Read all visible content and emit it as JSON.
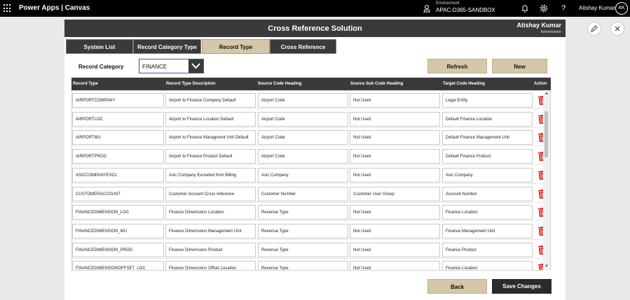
{
  "topbar": {
    "app_title": "Power Apps  |  Canvas",
    "environment_label": "Environment",
    "environment_name": "APAC-D365-SANDBOX",
    "help": "?",
    "user_name": "Atishay Kumar",
    "avatar_initials": "AK"
  },
  "header": {
    "title": "Cross Reference Solution",
    "user_name": "Atishay Kumar",
    "role": "Administrator"
  },
  "tabs": [
    {
      "label": "System List"
    },
    {
      "label": "Record Category Type"
    },
    {
      "label": "Record Type"
    },
    {
      "label": "Cross Reference"
    }
  ],
  "filter": {
    "label": "Record Category",
    "selected": "FINANCE"
  },
  "buttons": {
    "refresh": "Refresh",
    "new": "New",
    "back": "Back",
    "save": "Save Changes"
  },
  "table": {
    "columns": [
      "Record Type",
      "Record Type Description",
      "Source Code Heading",
      "Source Sub Code Heading",
      "Target Code Heading",
      "Action"
    ],
    "rows": [
      [
        "AIRPORTCOMPANY",
        "Airport to Finance Company Default",
        "Airport Code",
        "Not Used",
        "Legal Entity"
      ],
      [
        "AIRPORTLOC",
        "Airport to Finance Location Default",
        "Airport Code",
        "Not Used",
        "Default Finance Location"
      ],
      [
        "AIRPORTMU",
        "Airport to Finance Managment Unit Default",
        "Airport Code",
        "Not Used",
        "Default Finance Management Unit"
      ],
      [
        "AIRPORTPROD",
        "Airport to Finance Product Default",
        "Airport Code",
        "Not Used",
        "Default Finance Product"
      ],
      [
        "ASICCOMPANYEXCL",
        "Asic Company Excluded from Billing",
        "Asic Company",
        "Not Used",
        "Asic Company"
      ],
      [
        "CUSTOMERACCOUNT",
        "Customer Account Cross reference",
        "Customer Number",
        "Customer User Group",
        "Account Number"
      ],
      [
        "FINANCEDIMENSION_LOC",
        "Finance Dimensions Location",
        "Revenue Type",
        "Not Used",
        "Finance Location"
      ],
      [
        "FINANCEDIMENSION_MU",
        "Finance Dimensions Management Unit",
        "Revenue Type",
        "Not Used",
        "Finance Management Unit"
      ],
      [
        "FINANCEDIMENSION_PROD",
        "Finance Dimensions Product",
        "Revenue Type",
        "Not Used",
        "Finance Product"
      ],
      [
        "FINANCEDIMENSIONOFFSET_LOC",
        "Finance Dimensions Offset Location",
        "Revenue Type",
        "Not Used",
        "Finance Location"
      ]
    ]
  },
  "colors": {
    "dark": "#3a3a3a",
    "tan": "#d6c7a8",
    "delete_red": "#e02020"
  },
  "icons": [
    "waffle-icon",
    "environment-icon",
    "bell-icon",
    "gear-icon",
    "help-icon",
    "dropdown-chevron-icon",
    "trash-icon",
    "edit-pencil-icon",
    "close-icon"
  ]
}
